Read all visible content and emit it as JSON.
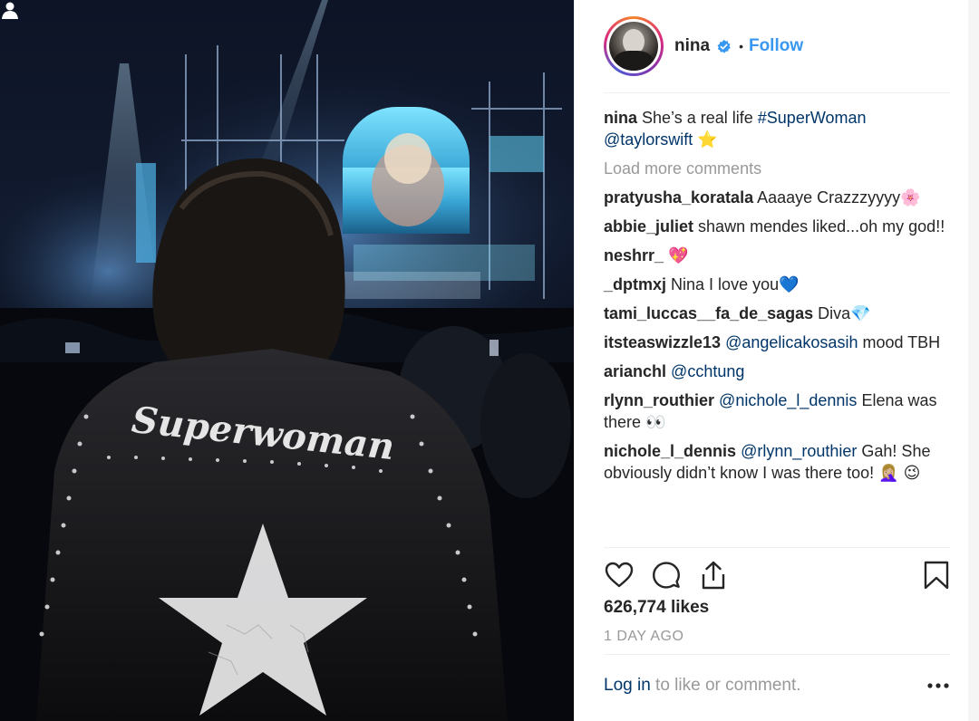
{
  "post": {
    "username": "nina",
    "follow_label": "Follow",
    "separator": "•",
    "caption": {
      "user": "nina",
      "text_before": "She’s a real life ",
      "hashtag": "#SuperWoman",
      "mention": "@taylorswift",
      "emoji": "⭐"
    },
    "load_more": "Load more comments",
    "likes": "626,774 likes",
    "time_ago": "1 DAY AGO"
  },
  "comments": [
    {
      "user": "pratyusha_koratala",
      "text": "Aaaaye Crazzzyyyy🌸"
    },
    {
      "user": "abbie_juliet",
      "text": "shawn mendes liked...oh my god!!"
    },
    {
      "user": "neshrr_",
      "text": "💖"
    },
    {
      "user": "_dptmxj",
      "text": "Nina I love you💙"
    },
    {
      "user": "tami_luccas__fa_de_sagas",
      "text": "Diva💎"
    },
    {
      "user": "itsteaswizzle13",
      "mention": "@angelicakosasih",
      "text": " mood TBH"
    },
    {
      "user": "arianchl",
      "mention": "@cchtung",
      "text": ""
    },
    {
      "user": "rlynn_routhier",
      "mention": "@nichole_l_dennis",
      "text": " Elena was there 👀"
    },
    {
      "user": "nichole_l_dennis",
      "mention": "@rlynn_routhier",
      "text": " Gah! She obviously didn’t know I was there too! 🤦🏼‍♀️ 😉"
    }
  ],
  "footer": {
    "login_label": "Log in",
    "rest_text": " to like or comment."
  },
  "photo": {
    "jacket_text": "Superwoman"
  },
  "icons": {
    "like": "heart-icon",
    "comment": "comment-icon",
    "share": "share-icon",
    "save": "bookmark-icon",
    "more": "more-options-icon",
    "verified": "verified-badge-icon",
    "tag": "user-tag-icon"
  },
  "colors": {
    "accent": "#3897f0",
    "link": "#003569",
    "muted": "#999999",
    "text": "#262626"
  }
}
